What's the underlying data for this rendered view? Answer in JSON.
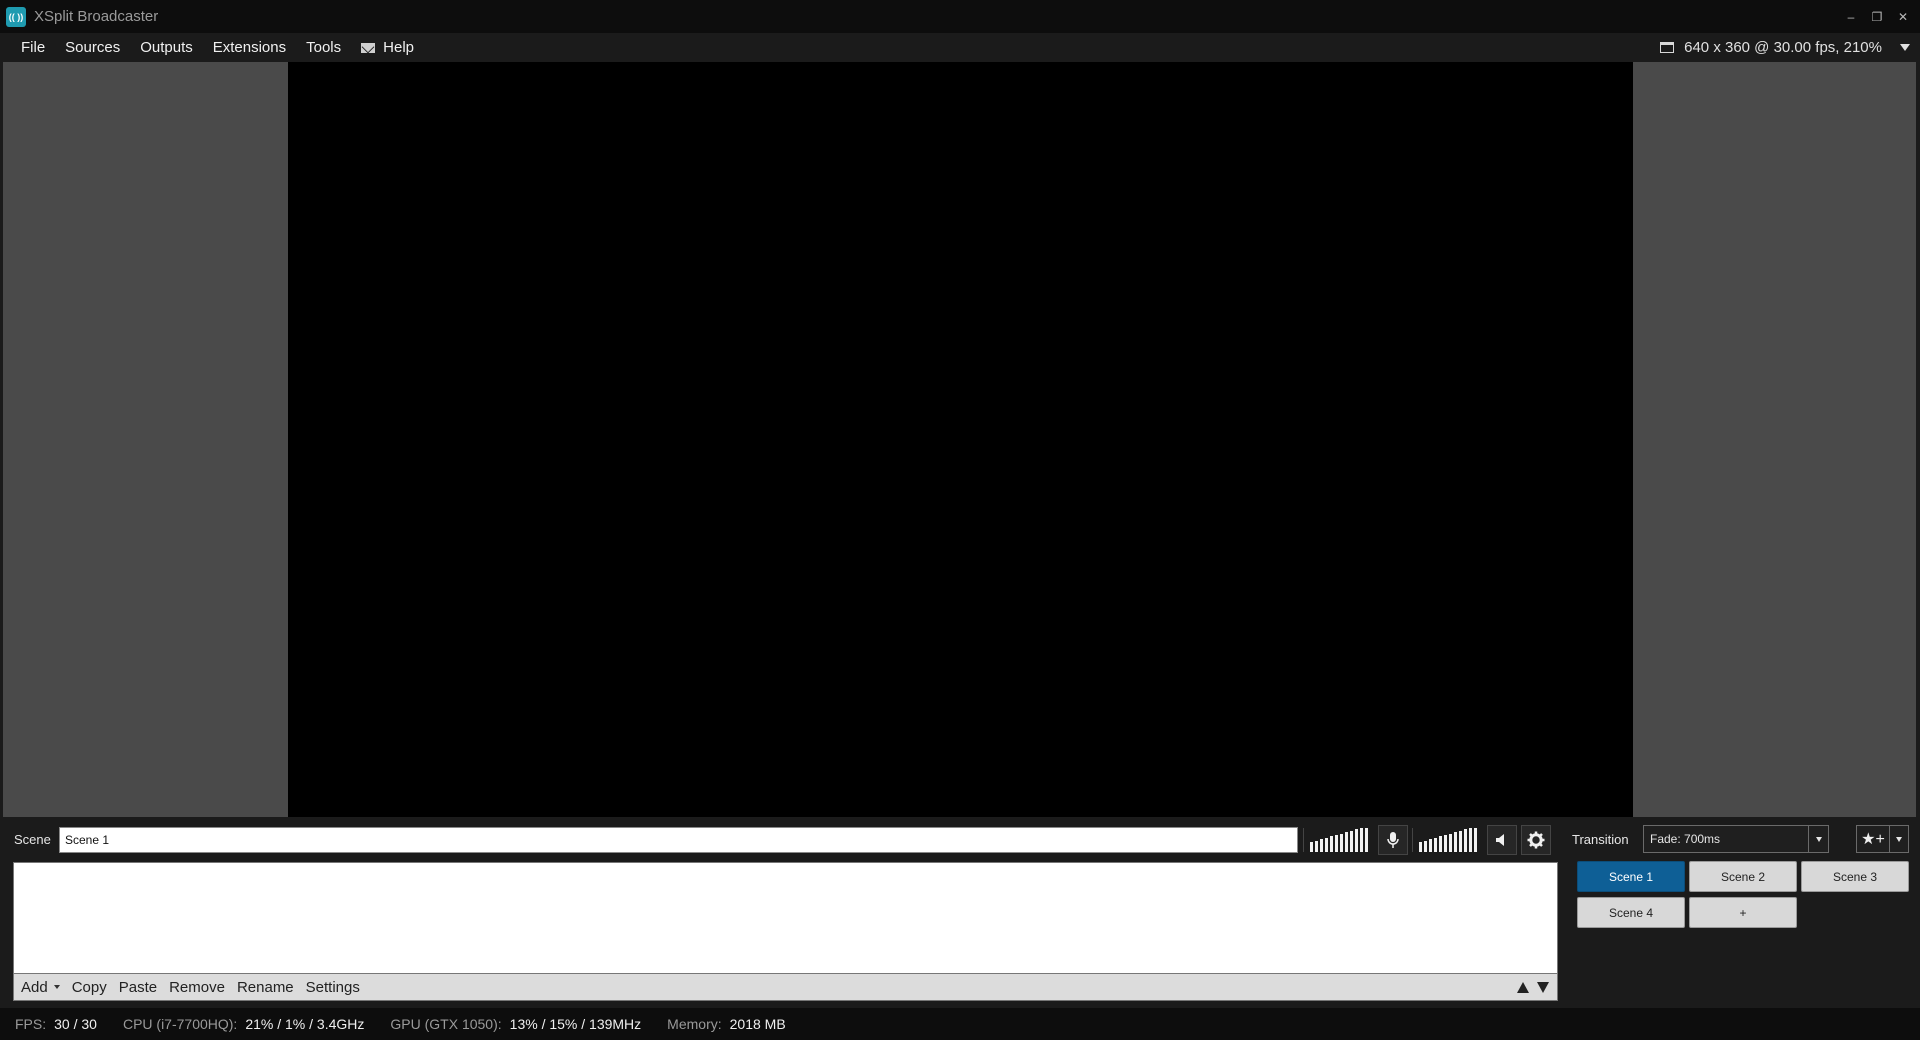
{
  "window": {
    "title": "XSplit Broadcaster",
    "logo_text": "(( ))",
    "controls": {
      "minimize": "–",
      "restore": "❐",
      "close": "✕"
    }
  },
  "menu": {
    "items": [
      "File",
      "Sources",
      "Outputs",
      "Extensions",
      "Tools"
    ],
    "help_label": "Help",
    "resolution": "640 x 360 @ 30.00 fps, 210%"
  },
  "scene": {
    "label": "Scene",
    "name_value": "Scene 1"
  },
  "audio": {
    "mic_meter_levels": [
      0.3,
      0.37,
      0.44,
      0.51,
      0.58,
      0.65,
      0.72,
      0.79,
      0.86,
      0.93,
      1.0,
      1.0
    ],
    "speaker_meter_levels": [
      0.3,
      0.37,
      0.44,
      0.51,
      0.58,
      0.65,
      0.72,
      0.79,
      0.86,
      0.93,
      1.0,
      1.0
    ],
    "icons": [
      "microphone-icon",
      "speaker-icon",
      "gear-icon"
    ]
  },
  "sources_toolbar": {
    "add": "Add",
    "copy": "Copy",
    "paste": "Paste",
    "remove": "Remove",
    "rename": "Rename",
    "settings": "Settings"
  },
  "transition": {
    "label": "Transition",
    "selected": "Fade: 700ms",
    "add_icon": "★+"
  },
  "scenes": {
    "buttons": [
      "Scene 1",
      "Scene 2",
      "Scene 3",
      "Scene 4",
      "+"
    ],
    "active_index": 0
  },
  "status": {
    "fps_label": "FPS:",
    "fps_value": "30 / 30",
    "cpu_label": "CPU (i7-7700HQ):",
    "cpu_value": "21% / 1% / 3.4GHz",
    "gpu_label": "GPU (GTX 1050):",
    "gpu_value": "13% / 15% / 139MHz",
    "memory_label": "Memory:",
    "memory_value": "2018 MB"
  },
  "colors": {
    "accent": "#0e5f96",
    "background": "#1b1b1b",
    "preview_backdrop": "#4a4a4a",
    "canvas": "#000000"
  }
}
